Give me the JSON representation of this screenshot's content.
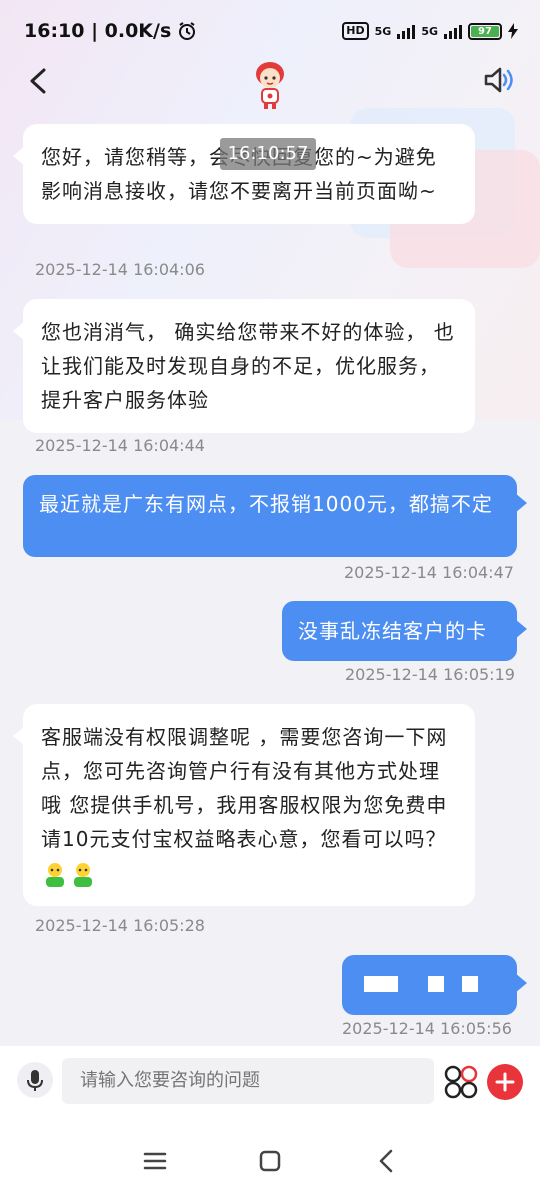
{
  "status_bar": {
    "time_speed": "16:10 | 0.0K/s",
    "hd": "HD",
    "net1": "5G",
    "net2": "5G",
    "battery": "97"
  },
  "overlay_time": "16:10:57",
  "messages": [
    {
      "side": "left",
      "text": "您好，请您稍等，会尽快回复您的~为避免影响消息接收，请您不要离开当前页面呦~",
      "time": "2025-12-14 16:04:06"
    },
    {
      "side": "left",
      "text": "您也消消气， 确实给您带来不好的体验， 也让我们能及时发现自身的不足，优化服务，提升客户服务体验",
      "time": "2025-12-14 16:04:44"
    },
    {
      "side": "right",
      "text": "最近就是广东有网点，不报销1000元，都搞不定",
      "time": "2025-12-14 16:04:47"
    },
    {
      "side": "right",
      "text": "没事乱冻结客户的卡",
      "time": "2025-12-14 16:05:19"
    },
    {
      "side": "left",
      "text": "客服端没有权限调整呢 ，需要您咨询一下网点，您可先咨询管户行有没有其他方式处理哦 您提供手机号，我用客服权限为您免费申请10元支付宝权益略表心意，您看可以吗？",
      "time": "2025-12-14 16:05:28"
    },
    {
      "side": "right",
      "text": "",
      "time": "2025-12-14 16:05:56"
    }
  ],
  "input": {
    "placeholder": "请输入您要咨询的问题"
  },
  "icons": {
    "back": "chevron-left-icon",
    "avatar": "assistant-avatar",
    "sound": "speaker-icon",
    "mic": "microphone-icon",
    "apps": "apps-icon",
    "plus": "plus-icon"
  },
  "colors": {
    "accent": "#4d8ef2",
    "plus": "#e8343a"
  }
}
